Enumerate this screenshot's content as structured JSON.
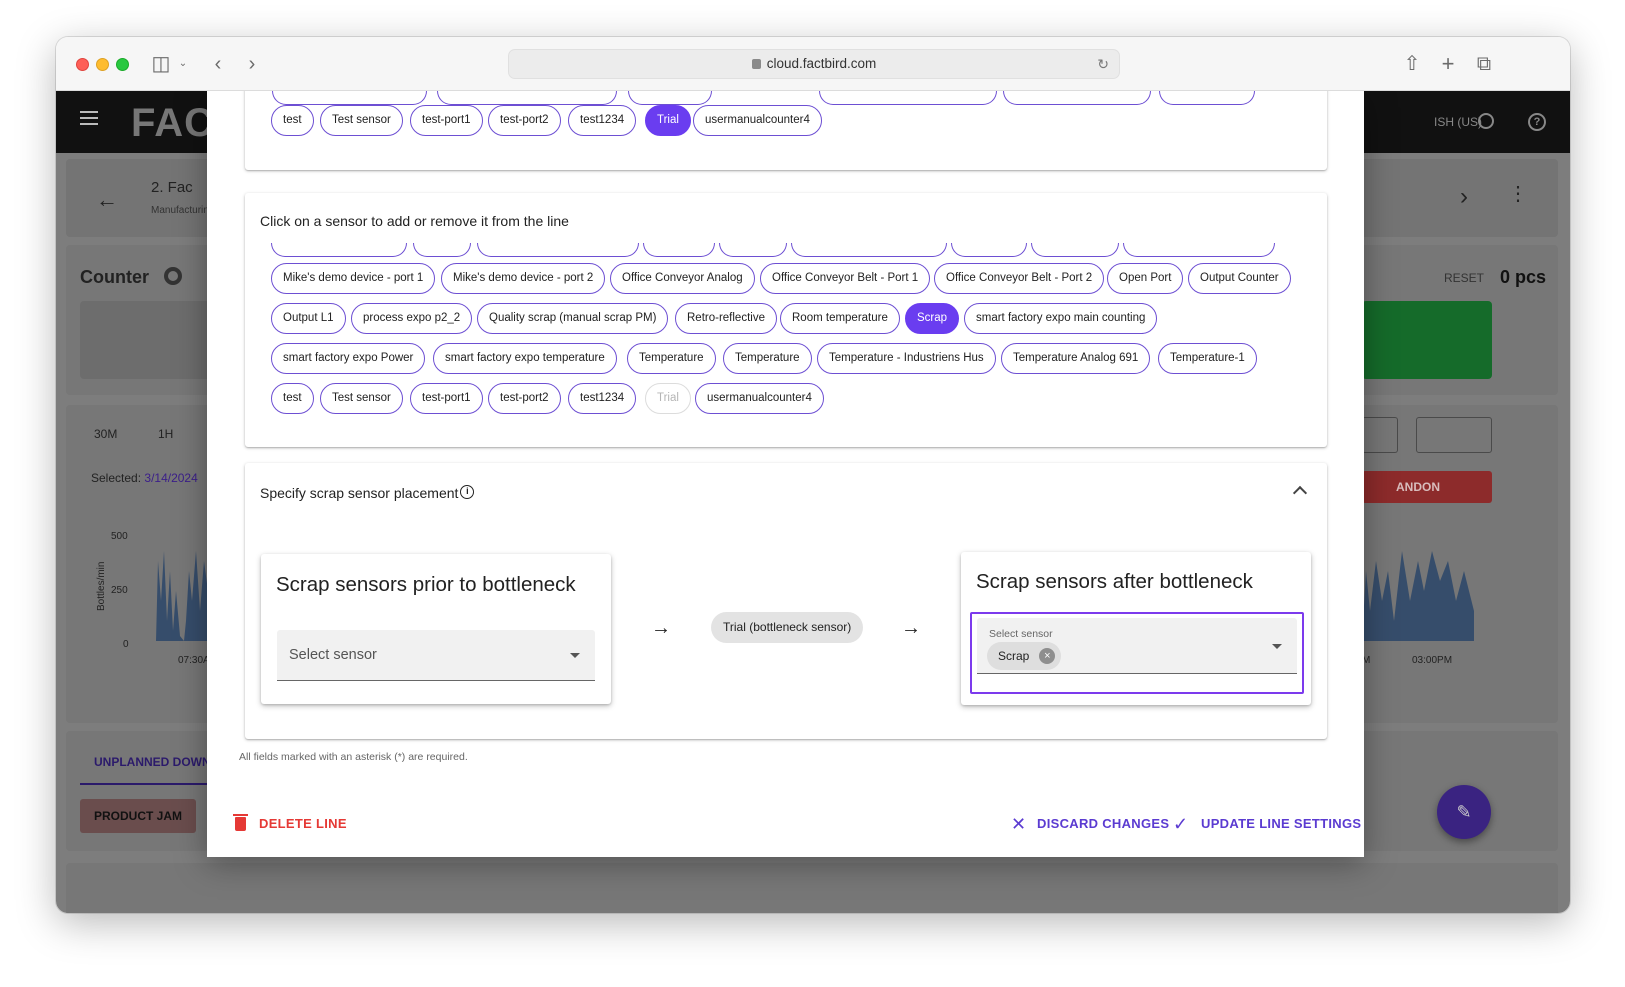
{
  "browser": {
    "url": "cloud.factbird.com"
  },
  "app": {
    "logo": "FAC",
    "language": "ISH (US)",
    "breadcrumb": "2. Fac",
    "breadcrumb_sub": "Manufacturing",
    "counter_title": "Counter",
    "reset_label": "RESET",
    "count": "0 pcs",
    "range_30m": "30M",
    "range_1h": "1H",
    "selected_label": "Selected:",
    "selected_date": "3/14/2024",
    "andon_label": "ANDON",
    "y_axis_label": "Bottles/min",
    "y_ticks": [
      "500",
      "250",
      "0"
    ],
    "x_tick_left": "07:30A",
    "x_tick_right_a": "M",
    "x_tick_right_b": "03:00PM",
    "unplanned_tab": "UNPLANNED DOWN",
    "product_jam": "PRODUCT JAM",
    "fab_icon": "pencil-icon"
  },
  "top_card": {
    "chips": [
      {
        "label": "test",
        "state": "normal"
      },
      {
        "label": "Test sensor",
        "state": "normal"
      },
      {
        "label": "test-port1",
        "state": "normal"
      },
      {
        "label": "test-port2",
        "state": "normal"
      },
      {
        "label": "test1234",
        "state": "normal"
      },
      {
        "label": "Trial",
        "state": "selected"
      },
      {
        "label": "usermanualcounter4",
        "state": "normal"
      }
    ]
  },
  "sensor_card": {
    "instruction": "Click on a sensor to add or remove it from the line",
    "row1": [
      {
        "label": "Mike's demo device - port 1",
        "state": "normal"
      },
      {
        "label": "Mike's demo device - port 2",
        "state": "normal"
      },
      {
        "label": "Office Conveyor Analog",
        "state": "normal"
      },
      {
        "label": "Office Conveyor Belt - Port 1",
        "state": "normal"
      },
      {
        "label": "Office Conveyor Belt - Port 2",
        "state": "normal"
      },
      {
        "label": "Open Port",
        "state": "normal"
      },
      {
        "label": "Output Counter",
        "state": "normal"
      }
    ],
    "row2": [
      {
        "label": "Output L1",
        "state": "normal"
      },
      {
        "label": "process expo p2_2",
        "state": "normal"
      },
      {
        "label": "Quality scrap (manual scrap PM)",
        "state": "normal"
      },
      {
        "label": "Retro-reflective",
        "state": "normal"
      },
      {
        "label": "Room temperature",
        "state": "normal"
      },
      {
        "label": "Scrap",
        "state": "selected"
      },
      {
        "label": "smart factory expo main counting",
        "state": "normal"
      }
    ],
    "row3": [
      {
        "label": "smart factory expo Power",
        "state": "normal"
      },
      {
        "label": "smart factory expo temperature",
        "state": "normal"
      },
      {
        "label": "Temperature",
        "state": "normal"
      },
      {
        "label": "Temperature",
        "state": "normal"
      },
      {
        "label": "Temperature - Industriens Hus",
        "state": "normal"
      },
      {
        "label": "Temperature Analog 691",
        "state": "normal"
      },
      {
        "label": "Temperature-1",
        "state": "normal"
      }
    ],
    "row4": [
      {
        "label": "test",
        "state": "normal"
      },
      {
        "label": "Test sensor",
        "state": "normal"
      },
      {
        "label": "test-port1",
        "state": "normal"
      },
      {
        "label": "test-port2",
        "state": "normal"
      },
      {
        "label": "test1234",
        "state": "normal"
      },
      {
        "label": "Trial",
        "state": "disabled"
      },
      {
        "label": "usermanualcounter4",
        "state": "normal"
      }
    ]
  },
  "scrap_card": {
    "title": "Specify scrap sensor placement",
    "prior": {
      "title": "Scrap sensors prior to bottleneck",
      "placeholder": "Select sensor"
    },
    "bottleneck_chip": "Trial (bottleneck sensor)",
    "after": {
      "title": "Scrap sensors after bottleneck",
      "field_label": "Select sensor",
      "selected": "Scrap"
    }
  },
  "footer": {
    "required_note": "All fields marked with an asterisk (*) are required.",
    "delete_label": "DELETE LINE",
    "discard_label": "DISCARD CHANGES",
    "update_label": "UPDATE LINE SETTINGS"
  },
  "colors": {
    "accent": "#6a3df0",
    "danger": "#e53935",
    "action": "#5b3bd1",
    "focus": "#7c3aed"
  }
}
